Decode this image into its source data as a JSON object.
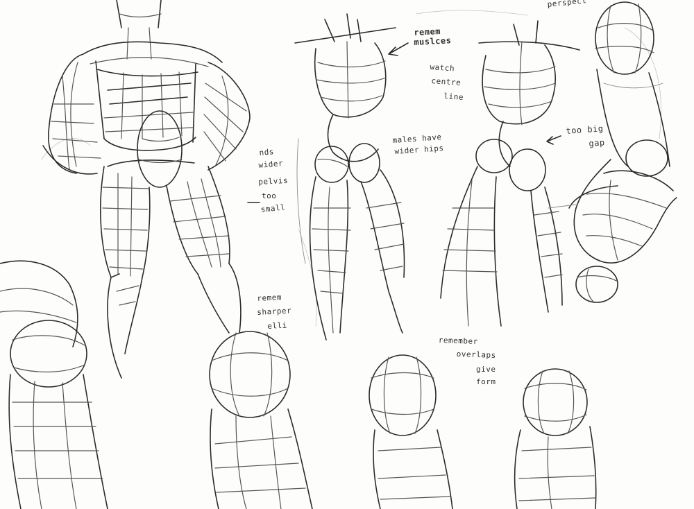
{
  "notes": {
    "perspect": "perspect",
    "rem_muscles_1": "remem",
    "rem_muscles_2": "muslces",
    "watch_1": "watch",
    "watch_2": "centre",
    "watch_3": "line",
    "males_1": "males have",
    "males_2": "wider hips",
    "needs_1": "nds",
    "needs_2": "wider",
    "needs_3": "pelvis",
    "needs_4": "too",
    "needs_5": "small",
    "toobig_1": "too big",
    "toobig_2": "gap",
    "sharper_1": "remem",
    "sharper_2": "sharper",
    "sharper_3": "elli",
    "overlaps_1": "remember",
    "overlaps_2": "overlaps",
    "overlaps_3": "give",
    "overlaps_4": "form"
  },
  "colors": {
    "paper": "#fdfdfc",
    "graphite_dark": "#2b2b2b",
    "graphite_mid": "#555555",
    "graphite_light": "#8a8a8a"
  }
}
